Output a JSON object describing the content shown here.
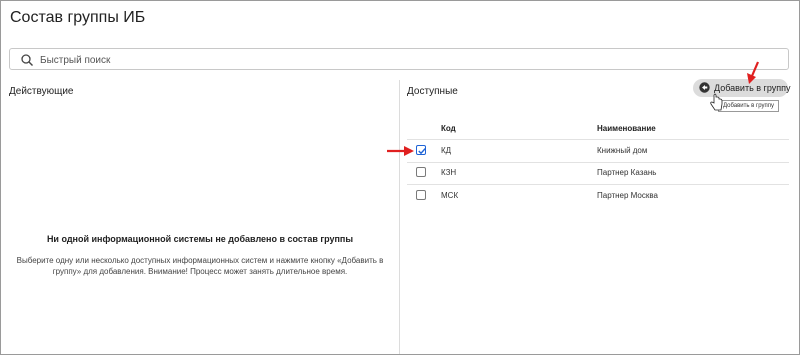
{
  "page": {
    "title": "Состав группы ИБ"
  },
  "search": {
    "placeholder": "Быстрый поиск",
    "icon": "search-icon"
  },
  "left_panel": {
    "title": "Действующие",
    "empty_title": "Ни одной информационной системы не добавлено в состав группы",
    "empty_text": "Выберите одну или несколько доступных информационных систем и нажмите кнопку «Добавить в группу» для добавления. Внимание! Процесс может занять длительное время."
  },
  "right_panel": {
    "title": "Доступные",
    "add_button": {
      "label": "Добавить в группу",
      "icon": "arrow-left-circle-icon",
      "tooltip": "Добавить в группу"
    },
    "columns": {
      "code": "Код",
      "name": "Наименование"
    },
    "rows": [
      {
        "code": "КД",
        "name": "Книжный дом",
        "checked": true
      },
      {
        "code": "КЗН",
        "name": "Партнер Казань",
        "checked": false
      },
      {
        "code": "МСК",
        "name": "Партнер Москва",
        "checked": false
      }
    ]
  },
  "colors": {
    "checkbox_accent": "#1e63d6",
    "annotation_red": "#e02020",
    "button_bg": "#dcdcdc"
  }
}
